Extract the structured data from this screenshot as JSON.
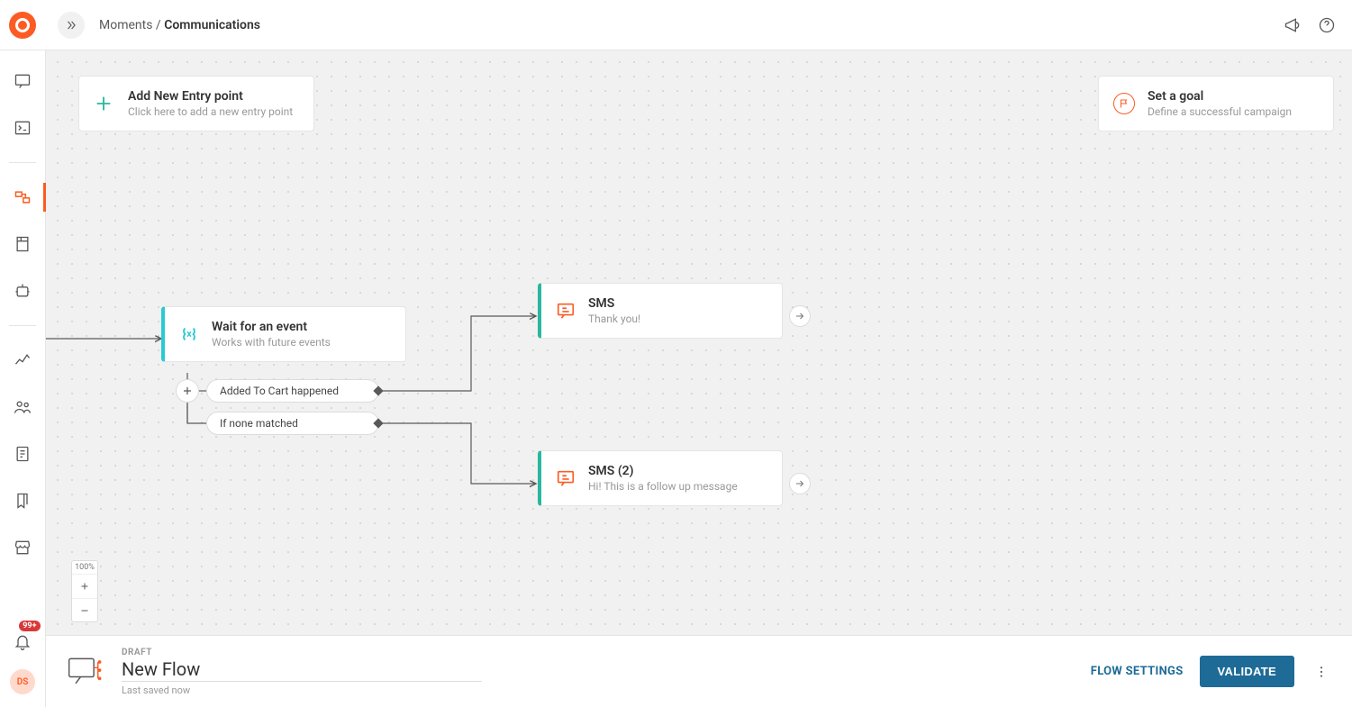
{
  "header": {
    "breadcrumb_parent": "Moments",
    "breadcrumb_sep": " / ",
    "breadcrumb_current": "Communications"
  },
  "sidebar": {
    "notification_badge": "99+",
    "avatar_initials": "DS"
  },
  "canvas": {
    "entry": {
      "title": "Add New Entry point",
      "subtitle": "Click here to add a new entry point"
    },
    "goal": {
      "title": "Set a goal",
      "subtitle": "Define a successful campaign"
    },
    "nodes": {
      "wait": {
        "title": "Wait for an event",
        "subtitle": "Works with future events"
      },
      "sms1": {
        "title": "SMS",
        "subtitle": "Thank you!"
      },
      "sms2": {
        "title": "SMS (2)",
        "subtitle": "Hi! This is a follow up message"
      }
    },
    "branches": {
      "branch1": "Added To Cart happened",
      "branch2": "If none matched"
    },
    "zoom": {
      "label": "100%"
    }
  },
  "footer": {
    "status": "DRAFT",
    "title": "New Flow",
    "saved": "Last saved now",
    "settings": "FLOW SETTINGS",
    "validate": "VALIDATE"
  }
}
